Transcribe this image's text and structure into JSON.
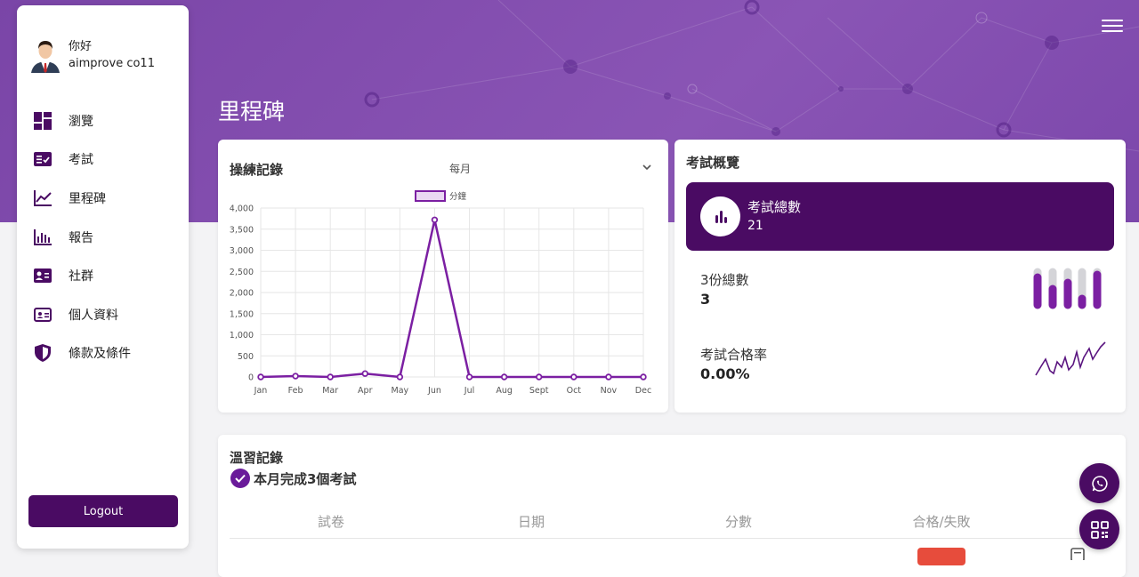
{
  "page": {
    "title": "里程碑"
  },
  "user": {
    "greeting": "你好",
    "name": "aimprove co11"
  },
  "sidebar": {
    "items": [
      {
        "label": "瀏覽",
        "icon": "dashboard-icon"
      },
      {
        "label": "考試",
        "icon": "exam-icon"
      },
      {
        "label": "里程碑",
        "icon": "line-chart-icon"
      },
      {
        "label": "報告",
        "icon": "bar-chart-icon"
      },
      {
        "label": "社群",
        "icon": "id-card-icon"
      },
      {
        "label": "個人資料",
        "icon": "profile-card-icon"
      },
      {
        "label": "條款及條件",
        "icon": "shield-icon"
      }
    ],
    "logout_label": "Logout"
  },
  "practice": {
    "title": "操練記錄",
    "period": "每月"
  },
  "overview": {
    "title": "考試概覽",
    "total_label": "考試總數",
    "total_value": "21",
    "three_label": "3份總數",
    "three_value": "3",
    "pass_label": "考試合格率",
    "pass_value": "0.00%"
  },
  "review": {
    "title": "溫習記錄",
    "summary": "本月完成3個考試",
    "columns": [
      "試卷",
      "日期",
      "分數",
      "合格/失敗"
    ]
  },
  "colors": {
    "primary": "#4a0b63",
    "accent": "#7b1fa2",
    "hero": "#8050b0",
    "fail": "#e74c3c"
  },
  "chart_data": {
    "type": "line",
    "categories": [
      "Jan",
      "Feb",
      "Mar",
      "Apr",
      "May",
      "Jun",
      "Jul",
      "Aug",
      "Sept",
      "Oct",
      "Nov",
      "Dec"
    ],
    "series": [
      {
        "name": "分鐘",
        "values": [
          0,
          20,
          0,
          80,
          0,
          3720,
          0,
          0,
          0,
          0,
          0,
          0
        ],
        "color": "#7b1fa2"
      }
    ],
    "ylim": [
      0,
      4000
    ],
    "yticks": [
      0,
      500,
      1000,
      1500,
      2000,
      2500,
      3000,
      3500,
      4000
    ],
    "ytick_labels": [
      "0",
      "500",
      "1,000",
      "1,500",
      "2,000",
      "2,500",
      "3,000",
      "3,500",
      "4,000"
    ],
    "grid": true,
    "legend": "top-center"
  }
}
